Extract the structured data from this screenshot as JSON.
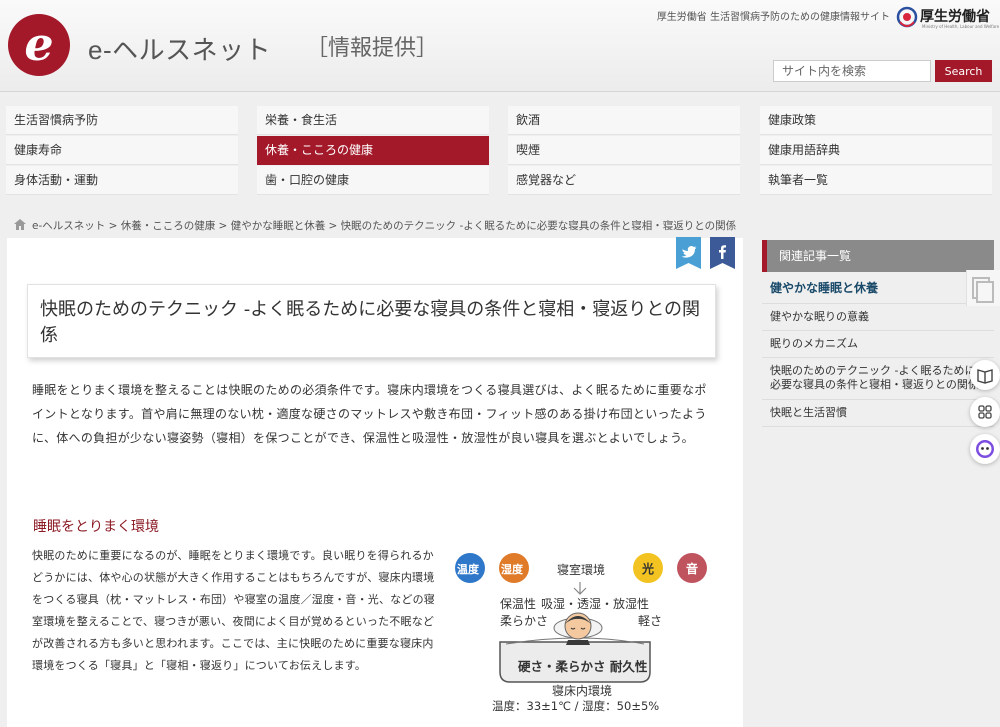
{
  "header": {
    "logo_letter": "e",
    "site_name": "e-ヘルスネット",
    "site_tag": "［情報提供］",
    "ministry_desc": "厚生労働省 生活習慣病予防のための健康情報サイト",
    "ministry_name": "厚生労働省",
    "ministry_sub": "Ministry of Health, Labour and Welfare",
    "search_placeholder": "サイト内を検索",
    "search_button": "Search"
  },
  "nav": {
    "col1": [
      "生活習慣病予防",
      "健康寿命",
      "身体活動・運動"
    ],
    "col2": [
      "栄養・食生活",
      "休養・こころの健康",
      "歯・口腔の健康"
    ],
    "col3": [
      "飲酒",
      "喫煙",
      "感覚器など"
    ],
    "col4": [
      "健康政策",
      "健康用語辞典",
      "執筆者一覧"
    ],
    "active": "休養・こころの健康"
  },
  "breadcrumb": "e-ヘルスネット > 休養・こころの健康 > 健やかな睡眠と休養 > 快眠のためのテクニック -よく眠るために必要な寝具の条件と寝相・寝返りとの関係",
  "article": {
    "title": "快眠のためのテクニック -よく眠るために必要な寝具の条件と寝相・寝返りとの関係",
    "intro": "睡眠をとりまく環境を整えることは快眠のための必須条件です。寝床内環境をつくる寝具選びは、よく眠るために重要なポイントとなります。首や肩に無理のない枕・適度な硬さのマットレスや敷き布団・フィット感のある掛け布団といったように、体への負担が少ない寝姿勢（寝相）を保つことができ、保温性と吸湿性・放湿性が良い寝具を選ぶとよいでしょう。",
    "section_heading": "睡眠をとりまく環境",
    "section_text": "快眠のために重要になるのが、睡眠をとりまく環境です。良い眠りを得られるかどうかには、体や心の状態が大きく作用することはもちろんですが、寝床内環境をつくる寝具（枕・マットレス・布団）や寝室の温度／湿度・音・光、などの寝室環境を整えることで、寝つきが悪い、夜間によく目が覚めるといった不眠などが改善される方も多いと思われます。ここでは、主に快眠のために重要な寝床内環境をつくる「寝具」と「寝相・寝返り」についてお伝えします。"
  },
  "diagram": {
    "bubble_temp": "温度",
    "bubble_humid": "湿度",
    "bubble_light": "光",
    "bubble_sound": "音",
    "room_env": "寝室環境",
    "insulation": "保温性",
    "softness": "柔らかさ",
    "moisture": "吸湿・透湿・放湿性",
    "lightness": "軽さ",
    "mattress": "硬さ・柔らかさ 耐久性",
    "bed_env": "寝床内環境",
    "bed_values": "温度：33±1℃ / 湿度：50±5%",
    "colors": {
      "temp": "#2f78c9",
      "humid": "#e07b2a",
      "light": "#f2c321",
      "sound": "#c0545e"
    }
  },
  "sidebar": {
    "heading": "関連記事一覧",
    "category": "健やかな睡眠と休養",
    "items": [
      "健やかな眠りの意義",
      "眠りのメカニズム",
      "快眠のためのテクニック -よく眠るために必要な寝具の条件と寝相・寝返りとの関係",
      "快眠と生活習慣"
    ]
  },
  "share": {
    "twitter": "twitter-icon",
    "facebook": "facebook-icon"
  },
  "colors": {
    "brand": "#a3192a",
    "twitter": "#4aa0d5",
    "facebook": "#3d5a98"
  }
}
